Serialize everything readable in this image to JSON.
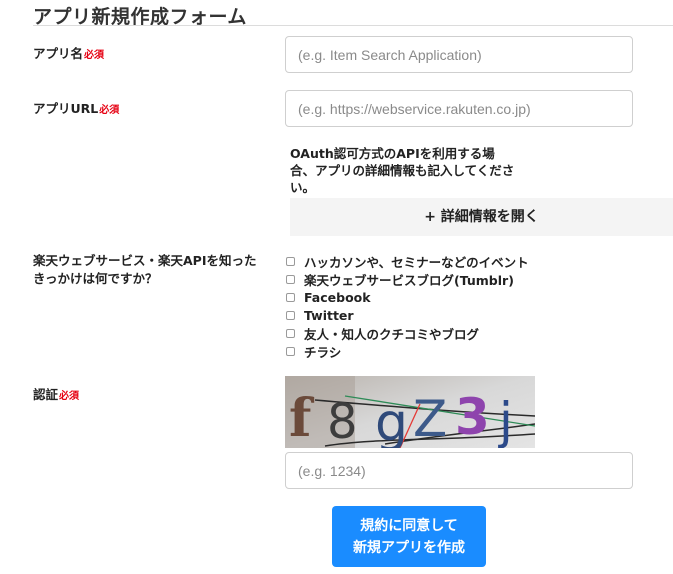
{
  "page_title": "アプリ新規作成フォーム",
  "required_label": "必須",
  "fields": {
    "app_name": {
      "label": "アプリ名",
      "placeholder": "(e.g. Item Search Application)"
    },
    "app_url": {
      "label": "アプリURL",
      "placeholder": "(e.g. https://webservice.rakuten.co.jp)"
    },
    "captcha": {
      "label": "認証",
      "placeholder": "(e.g. 1234)",
      "image_text": "f8gZ3j"
    }
  },
  "oauth_note": "OAuth認可方式のAPIを利用する場合、アプリの詳細情報も記入してください。",
  "detail_button": "+ 詳細情報を開く",
  "source_question": {
    "label": "楽天ウェブサービス・楽天APIを知ったきっかけは何ですか？",
    "options": [
      "ハッカソンや、セミナーなどのイベント",
      "楽天ウェブサービスブログ(Tumblr)",
      "Facebook",
      "Twitter",
      "友人・知人のクチコミやブログ",
      "チラシ"
    ]
  },
  "submit_button": {
    "line1": "規約に同意して",
    "line2": "新規アプリを作成"
  }
}
